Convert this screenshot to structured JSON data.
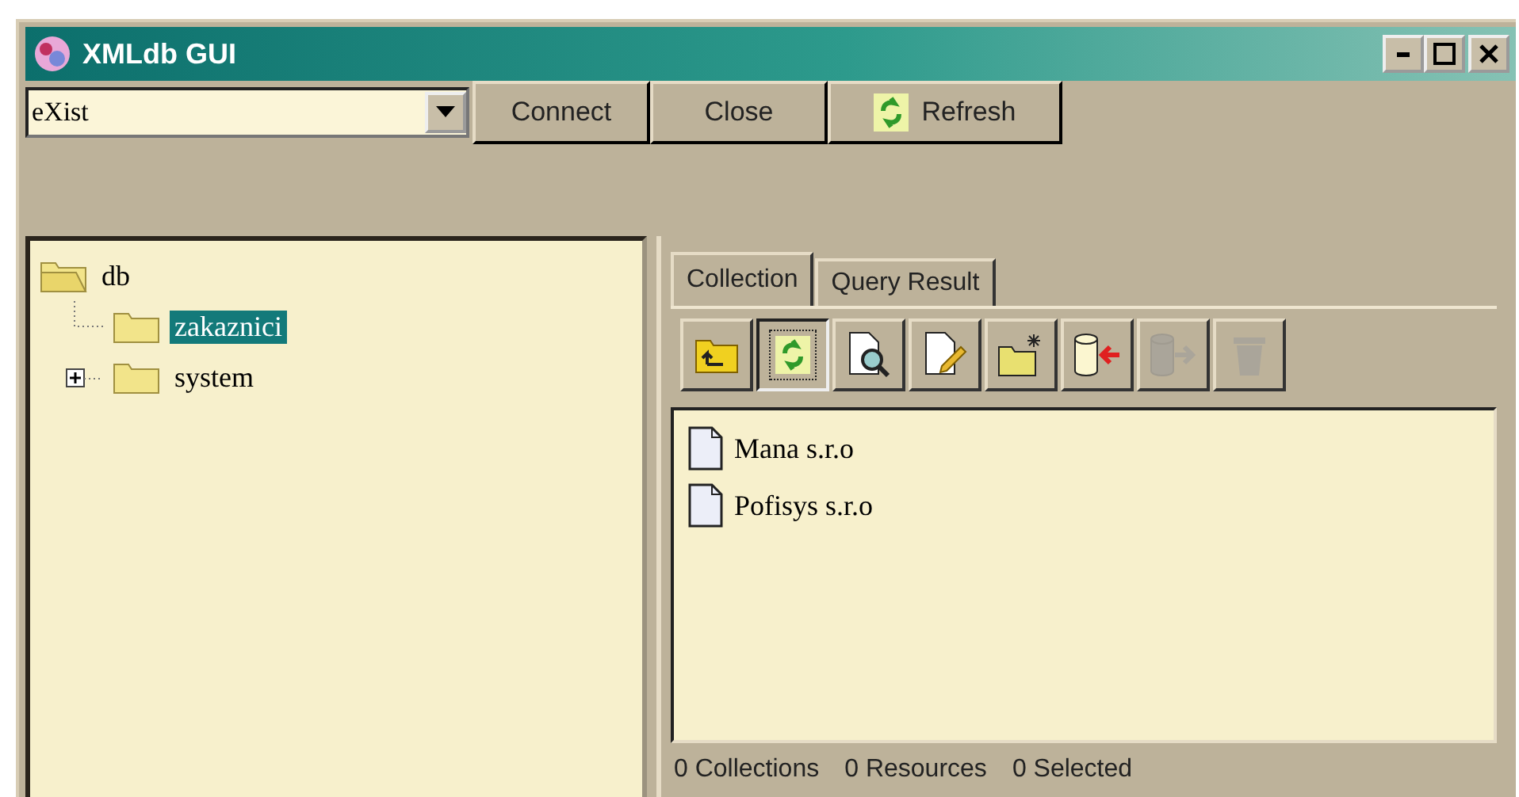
{
  "window": {
    "title": "XMLdb GUI"
  },
  "connection": {
    "value": "eXist"
  },
  "buttons": [
    {
      "label": "Connect",
      "kind": "text"
    },
    {
      "label": "Close",
      "kind": "text"
    },
    {
      "label": "Refresh",
      "kind": "refresh"
    }
  ],
  "tree": [
    {
      "label": "db",
      "expanded": true,
      "selected": false,
      "children": [
        {
          "label": "zakaznici",
          "kind": "leaf",
          "selected": true
        },
        {
          "label": "system",
          "kind": "branch",
          "selected": false,
          "expanded": false
        }
      ]
    }
  ],
  "tabs": [
    {
      "label": "Collection",
      "selected": true
    },
    {
      "label": "Query Result",
      "selected": false
    }
  ],
  "tools": [
    {
      "kind": "up",
      "disabled": false,
      "pressed": false
    },
    {
      "kind": "refresh",
      "disabled": false,
      "pressed": true
    },
    {
      "kind": "view",
      "disabled": false,
      "pressed": false
    },
    {
      "kind": "edit",
      "disabled": false,
      "pressed": false
    },
    {
      "kind": "newfolder",
      "disabled": false,
      "pressed": false
    },
    {
      "kind": "import",
      "disabled": false,
      "pressed": false
    },
    {
      "kind": "export",
      "disabled": true,
      "pressed": false
    },
    {
      "kind": "trash",
      "disabled": true,
      "pressed": false
    }
  ],
  "resources": [
    {
      "name": "Mana s.r.o"
    },
    {
      "name": "Pofisys s.r.o"
    }
  ],
  "status_bar": [
    "0 Collections",
    "0 Resources",
    "0 Selected"
  ]
}
